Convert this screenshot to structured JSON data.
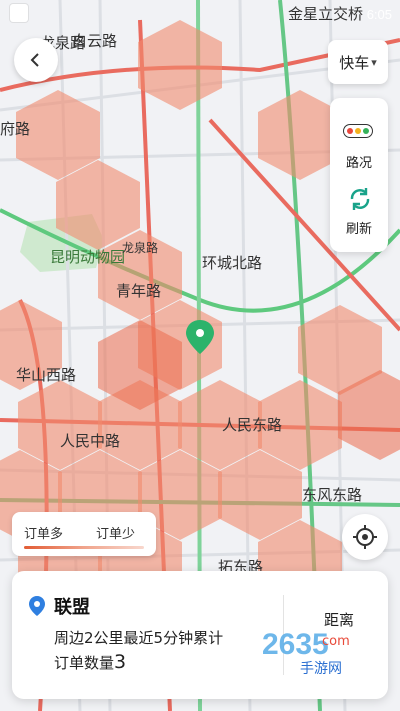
{
  "status_bar": {
    "street": "金星立交桥",
    "time": "6:05"
  },
  "top_bar": {
    "back_icon": "chevron-left-icon",
    "car_type": "快车",
    "car_type_chevron": "chevron-down-icon"
  },
  "side_panel": {
    "traffic_label": "路况",
    "refresh_label": "刷新",
    "traffic_icon": "traffic-light-icon",
    "refresh_icon": "refresh-icon",
    "traffic_colors": [
      "#e9463c",
      "#f3b21d",
      "#36b25a"
    ]
  },
  "legend": {
    "more": "订单多",
    "less": "订单少"
  },
  "locate_icon": "crosshair-icon",
  "map": {
    "streets": [
      "龙泉路",
      "白云路",
      "府路",
      "昆明动物园",
      "龙泉路",
      "青年路",
      "环城北路",
      "华山西路",
      "人民中路",
      "人民东路",
      "东风东路",
      "拓东路"
    ],
    "pin_icon": "location-pin-icon",
    "heat_color": "#f28a6e",
    "heat_color_strong": "#eb6b4d"
  },
  "card": {
    "pin_icon": "location-pin-icon",
    "title": "联盟",
    "line1": "周边2公里最近5分钟累计",
    "count_label": "订单数量",
    "count_value": "3",
    "right_label": "距离"
  },
  "watermark": {
    "text": "2635",
    "subtext": "手游网",
    "side": "com"
  }
}
